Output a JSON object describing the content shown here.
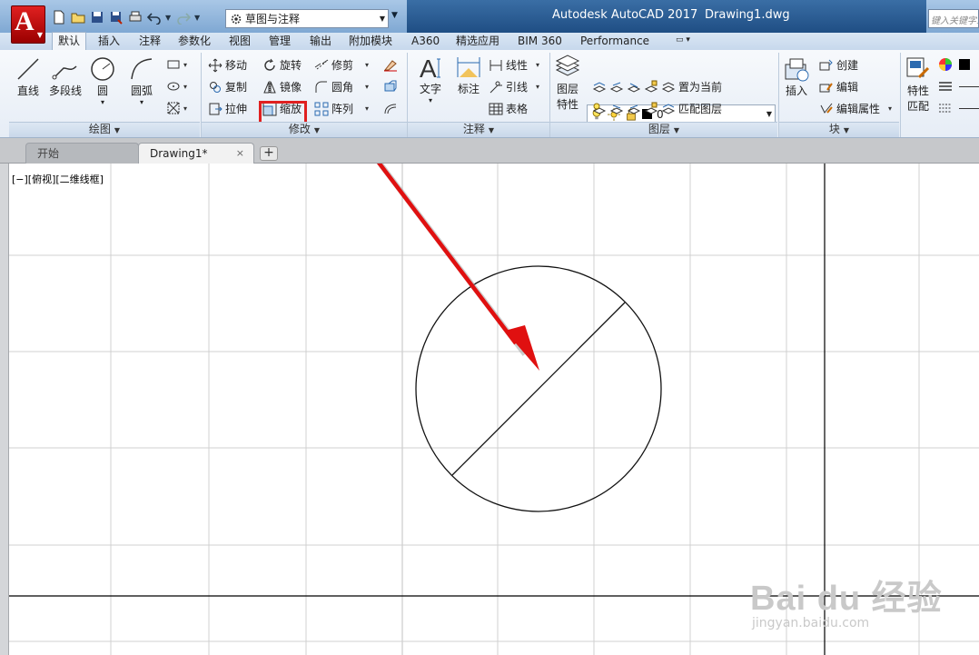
{
  "app": {
    "title": "Autodesk AutoCAD 2017",
    "file": "Drawing1.dwg",
    "logo_letter": "A",
    "workspace": "草图与注释",
    "search_placeholder": "键入关键字或短语"
  },
  "ribbon_tabs": [
    "默认",
    "插入",
    "注释",
    "参数化",
    "视图",
    "管理",
    "输出",
    "附加模块",
    "A360",
    "精选应用",
    "BIM 360",
    "Performance"
  ],
  "panels": {
    "draw": {
      "title": "绘图",
      "line": "直线",
      "polyline": "多段线",
      "circle": "圆",
      "arc": "圆弧"
    },
    "modify": {
      "title": "修改",
      "move": "移动",
      "rotate": "旋转",
      "trim": "修剪",
      "copy": "复制",
      "mirror": "镜像",
      "fillet": "圆角",
      "stretch": "拉伸",
      "scale": "缩放",
      "array": "阵列"
    },
    "annotation": {
      "title": "注释",
      "text": "文字",
      "dimension": "标注",
      "linear": "线性",
      "leader": "引线",
      "table": "表格"
    },
    "layers": {
      "title": "图层",
      "layer_properties_1": "图层",
      "layer_properties_2": "特性",
      "current_layer": "0",
      "set_current": "置为当前",
      "match_layer": "匹配图层"
    },
    "block": {
      "title": "块",
      "insert": "插入",
      "create": "创建",
      "edit": "编辑",
      "edit_attributes": "编辑属性"
    },
    "properties": {
      "match_1": "特性",
      "match_2": "匹配"
    }
  },
  "file_tabs": {
    "start": "开始",
    "drawing": "Drawing1*",
    "close": "×",
    "add": "+"
  },
  "viewport": {
    "label": "[−][俯视][二维线框]"
  },
  "watermark": {
    "brand": "Bai du 经验",
    "url": "jingyan.baidu.com"
  },
  "colors": {
    "highlight": "#e02020",
    "arrow": "#e01010",
    "title_bar": "#2a5a92"
  }
}
